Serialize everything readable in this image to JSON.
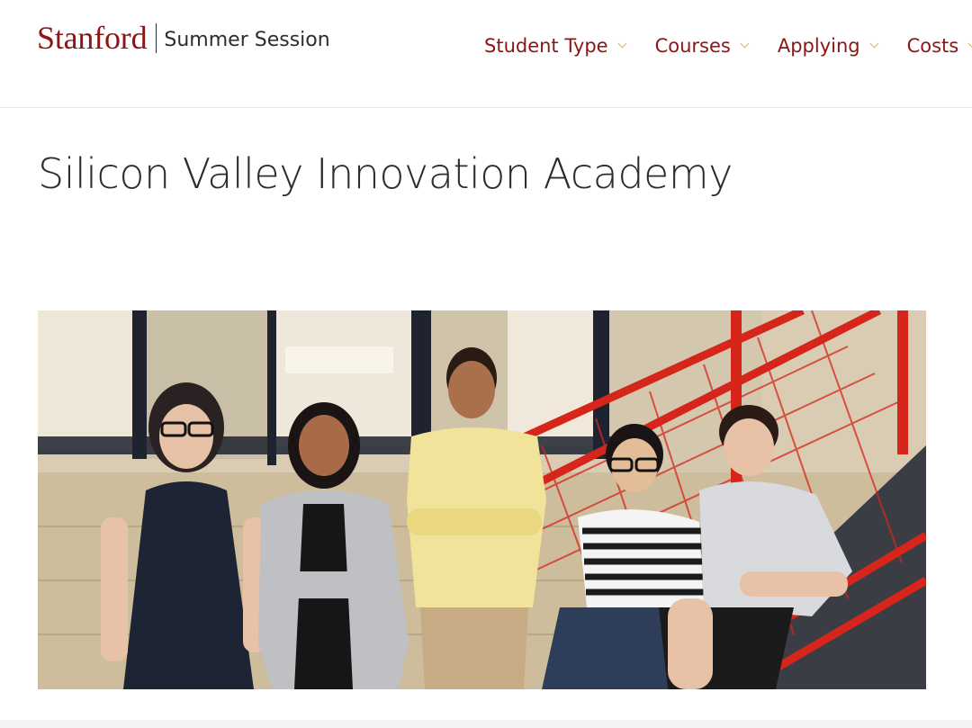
{
  "header": {
    "logo": {
      "wordmark": "Stanford",
      "unit": "Summer Session"
    },
    "nav": [
      {
        "label": "Student Type"
      },
      {
        "label": "Courses"
      },
      {
        "label": "Applying"
      },
      {
        "label": "Costs"
      }
    ]
  },
  "main": {
    "page_title": "Silicon Valley Innovation Academy",
    "hero_image": {
      "subject": "five students posing on a red staircase"
    }
  },
  "colors": {
    "brand_cardinal": "#8c1515",
    "chevron_gold": "#e0b34b",
    "text_dark": "#2e2d29",
    "stair_red": "#d6261c"
  }
}
